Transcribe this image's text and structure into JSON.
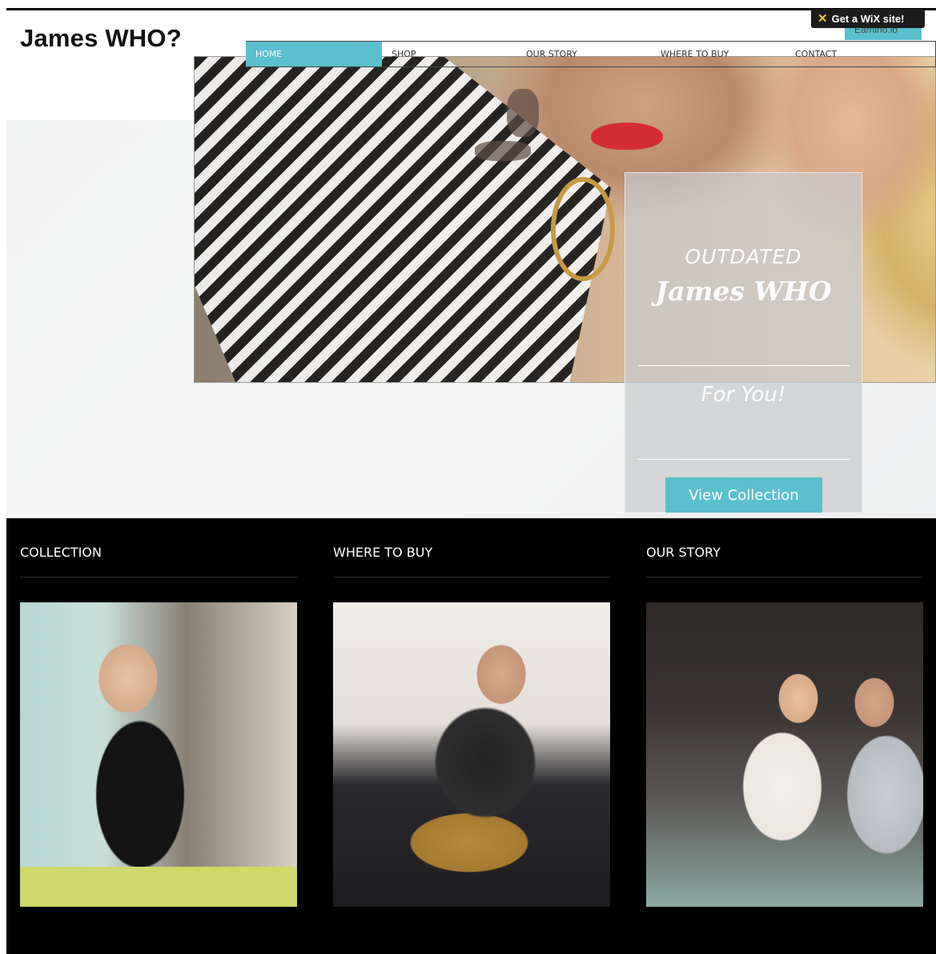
{
  "site": {
    "title": "James WHO?"
  },
  "wix_badge": {
    "label": "Get a WiX site!",
    "icon": "wix-x-icon"
  },
  "corner_tab": {
    "label": "Earnino.lo"
  },
  "nav": {
    "items": [
      {
        "label": "HOME",
        "active": true
      },
      {
        "label": "SHOP",
        "active": false
      },
      {
        "label": "OUR STORY",
        "active": false
      },
      {
        "label": "WHERE TO BUY",
        "active": false
      },
      {
        "label": "CONTACT",
        "active": false
      }
    ]
  },
  "promo": {
    "line1": "OUTDATED",
    "brand": "James WHO",
    "line2": "For You!",
    "button_label": "View Collection"
  },
  "footer": {
    "columns": [
      {
        "title": "COLLECTION"
      },
      {
        "title": "WHERE TO BUY"
      },
      {
        "title": "OUR STORY"
      }
    ]
  },
  "colors": {
    "accent": "#5bbfcd",
    "footer_bg": "#000000",
    "promo_overlay": "#c8cacd"
  }
}
